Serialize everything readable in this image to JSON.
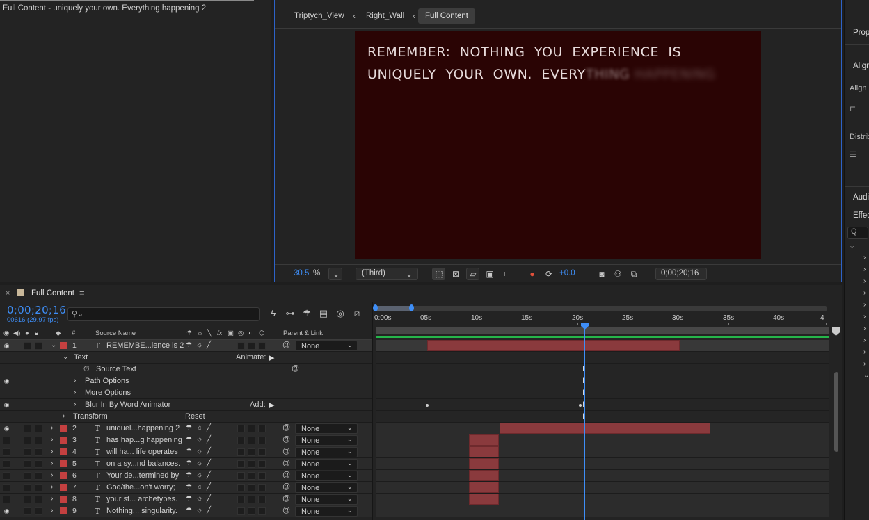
{
  "project_panel": {
    "caption": "Full Content - uniquely your own. Everything happening 2"
  },
  "viewer": {
    "breadcrumbs": [
      "Triptych_View",
      "Right_Wall",
      "Full Content"
    ],
    "comp_text_line1": "REMEMBER:  NOTHING  YOU  EXPERIENCE  IS",
    "comp_text_line2_clear": "UNIQUELY  YOUR  OWN.  EVERY",
    "comp_text_line2_fade": "THING",
    "comp_text_line2_blur": " HAPPENING",
    "zoom_value": "30.5",
    "zoom_unit": "%",
    "resolution": "(Third)",
    "exposure": "+0.0",
    "timecode": "0;00;20;16"
  },
  "right_panel": {
    "properties": "Properties",
    "align": "Align",
    "align_layers": "Align Layers to:",
    "distribute": "Distribute Layers:",
    "audio": "Audio",
    "effects": "Effects & Presets",
    "search_placeholder": "Q"
  },
  "timeline": {
    "tab_close": "×",
    "tab_title": "Full Content",
    "timecode": "0;00;20;16",
    "frames": "00616 (29.97 fps)",
    "columns": {
      "hash": "#",
      "source_name": "Source Name",
      "parent_link": "Parent & Link"
    },
    "ruler_ticks": [
      "0:00s",
      "05s",
      "10s",
      "15s",
      "20s",
      "25s",
      "30s",
      "35s",
      "40s",
      "4"
    ],
    "layer1": {
      "num": "1",
      "name": "REMEMBE...ience is 2",
      "parent": "None"
    },
    "props": {
      "text": "Text",
      "animate": "Animate:",
      "source_text": "Source Text",
      "path_options": "Path Options",
      "more_options": "More Options",
      "blur_animator": "Blur In By Word Animator",
      "add": "Add:",
      "transform": "Transform",
      "reset": "Reset"
    },
    "layers": [
      {
        "num": "2",
        "name": "uniquel...happening 2",
        "parent": "None"
      },
      {
        "num": "3",
        "name": "has hap...g happening",
        "parent": "None"
      },
      {
        "num": "4",
        "name": "will ha... life operates",
        "parent": "None"
      },
      {
        "num": "5",
        "name": "on a sy...nd balances.",
        "parent": "None"
      },
      {
        "num": "6",
        "name": "Your de...termined by",
        "parent": "None"
      },
      {
        "num": "7",
        "name": "God/the...on't worry;",
        "parent": "None"
      },
      {
        "num": "8",
        "name": "your st... archetypes.",
        "parent": "None"
      },
      {
        "num": "9",
        "name": "Nothing... singularity.",
        "parent": "None"
      }
    ]
  },
  "colors": {
    "accent": "#3e8ef7",
    "layer_label": "#c44040",
    "layer_bar": "#8a3a3d",
    "comp_bg": "#2a0404",
    "work_area": "#25b54a"
  }
}
